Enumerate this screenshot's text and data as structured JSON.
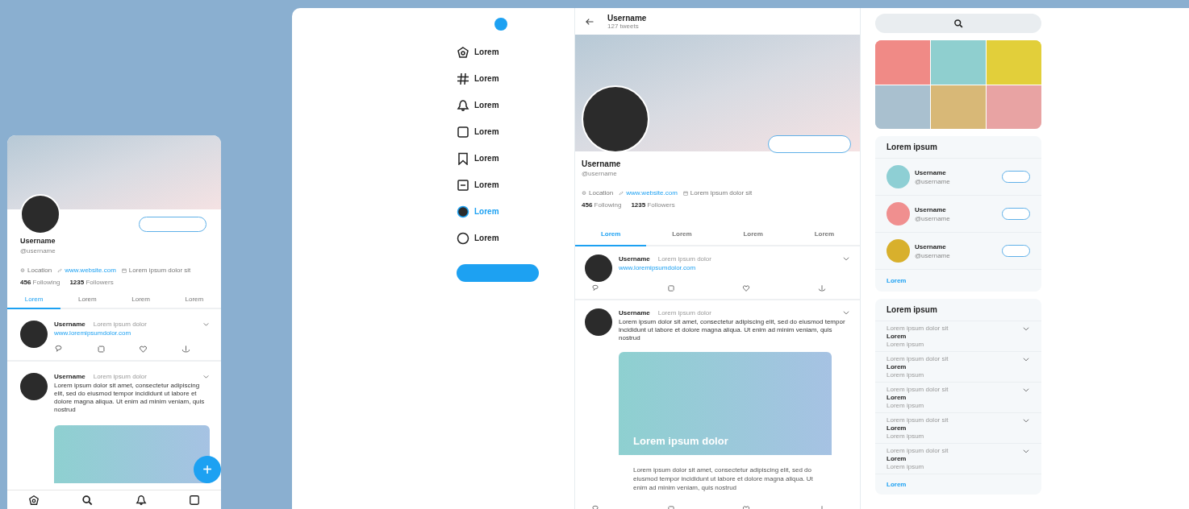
{
  "mobile": {
    "profile": {
      "name": "Username",
      "handle": "@username",
      "location": "Location",
      "website": "www.website.com",
      "joined": "Lorem ipsum dolor sit",
      "following_count": "456",
      "following_label": "Following",
      "followers_count": "1235",
      "followers_label": "Followers"
    },
    "tabs": [
      {
        "label": "Lorem",
        "selected": true
      },
      {
        "label": "Lorem",
        "selected": false
      },
      {
        "label": "Lorem",
        "selected": false
      },
      {
        "label": "Lorem",
        "selected": false
      }
    ],
    "posts": [
      {
        "name": "Username",
        "meta": "Lorem ipsum dolor",
        "link": "www.loremipsumdolor.com"
      },
      {
        "name": "Username",
        "meta": "Lorem ipsum dolor",
        "text": "Lorem ipsum dolor sit amet, consectetur adipiscing elit, sed do eiusmod tempor incididunt ut labore et dolore magna aliqua. Ut enim ad minim veniam, quis nostrud",
        "media": {
          "kind": "card"
        }
      }
    ],
    "fab": {
      "label": "+"
    },
    "bottom_nav": [
      {
        "kind": "home"
      },
      {
        "kind": "search"
      },
      {
        "kind": "bell"
      },
      {
        "kind": "square"
      }
    ]
  },
  "sidebar": {
    "items": [
      {
        "kind": "home",
        "label": "Lorem",
        "selected": false
      },
      {
        "kind": "hash",
        "label": "Lorem",
        "selected": false
      },
      {
        "kind": "bell",
        "label": "Lorem",
        "selected": false
      },
      {
        "kind": "square",
        "label": "Lorem",
        "selected": false
      },
      {
        "kind": "bookmark",
        "label": "Lorem",
        "selected": false
      },
      {
        "kind": "list",
        "label": "Lorem",
        "selected": false
      },
      {
        "kind": "profile",
        "label": "Lorem",
        "selected": true
      },
      {
        "kind": "circle",
        "label": "Lorem",
        "selected": false
      }
    ]
  },
  "profile": {
    "title": "Username",
    "tweet_count": "127 tweets",
    "name": "Username",
    "handle": "@username",
    "location": "Location",
    "website": "www.website.com",
    "joined": "Lorem ipsum dolor sit",
    "following_count": "456",
    "following_label": "Following",
    "followers_count": "1235",
    "followers_label": "Followers",
    "tabs": [
      {
        "label": "Lorem",
        "selected": true
      },
      {
        "label": "Lorem",
        "selected": false
      },
      {
        "label": "Lorem",
        "selected": false
      },
      {
        "label": "Lorem",
        "selected": false
      }
    ],
    "posts": [
      {
        "name": "Username",
        "meta": "Lorem ipsum dolor",
        "link": "www.loremipsumdolor.com"
      },
      {
        "name": "Username",
        "meta": "Lorem ipsum dolor",
        "text": "Lorem ipsum dolor sit amet, consectetur adipiscing elit, sed do eiusmod tempor incididunt ut labore et dolore magna aliqua. Ut enim ad minim veniam, quis nostrud",
        "media": {
          "kind": "card",
          "caption": "Lorem ipsum dolor",
          "body": "Lorem ipsum dolor sit amet, consectetur adipiscing elit, sed do eiusmod tempor incididunt ut labore et dolore magna aliqua. Ut enim ad minim veniam, quis nostrud"
        }
      }
    ]
  },
  "right": {
    "gallery": [
      {
        "color": "#f08a86"
      },
      {
        "color": "#8fcfcf"
      },
      {
        "color": "#e2cf3a"
      },
      {
        "color": "#a9c0cf"
      },
      {
        "color": "#d8b877"
      },
      {
        "color": "#e8a3a3"
      }
    ],
    "follow": {
      "title": "Lorem ipsum",
      "users": [
        {
          "name": "Username",
          "handle": "@username",
          "color": "#8ecfd4"
        },
        {
          "name": "Username",
          "handle": "@username",
          "color": "#f08f8f"
        },
        {
          "name": "Username",
          "handle": "@username",
          "color": "#d8b02c"
        }
      ],
      "more": "Lorem"
    },
    "trends": {
      "title": "Lorem ipsum",
      "items": [
        {
          "category": "Lorem ipsum dolor sit",
          "title": "Lorem",
          "subtitle": "Lorem ipsum"
        },
        {
          "category": "Lorem ipsum dolor sit",
          "title": "Lorem",
          "subtitle": "Lorem ipsum"
        },
        {
          "category": "Lorem ipsum dolor sit",
          "title": "Lorem",
          "subtitle": "Lorem ipsum"
        },
        {
          "category": "Lorem ipsum dolor sit",
          "title": "Lorem",
          "subtitle": "Lorem ipsum"
        },
        {
          "category": "Lorem ipsum dolor sit",
          "title": "Lorem",
          "subtitle": "Lorem ipsum"
        }
      ],
      "more": "Lorem"
    }
  }
}
